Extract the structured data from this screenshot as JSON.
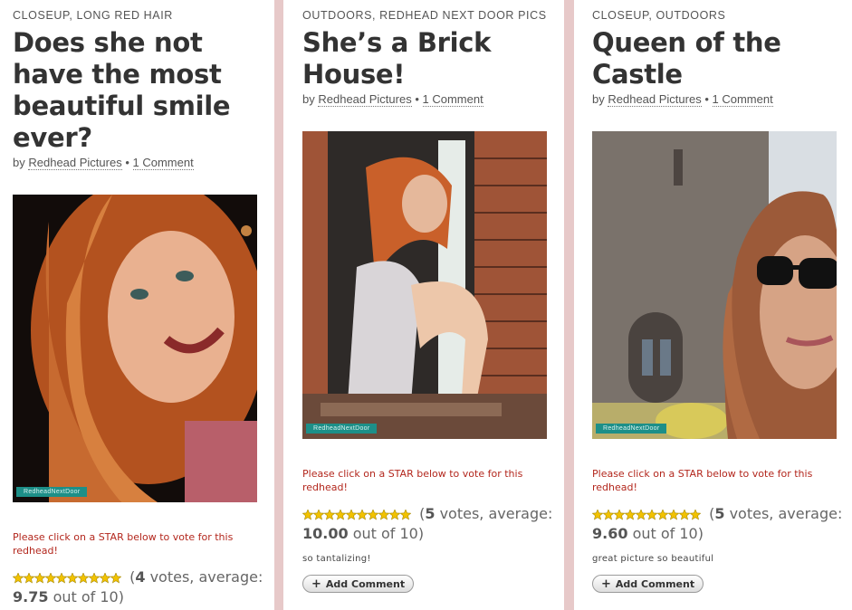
{
  "posts": [
    {
      "categories": "CLOSEUP, LONG RED HAIR",
      "title": "Does she not have the most beautiful smile ever?",
      "by": "by",
      "author": "Redhead Pictures",
      "separator": "•",
      "comments_link": "1 Comment",
      "watermark": "RedheadNextDoor",
      "vote_prompt": "Please click on a STAR below to vote for this redhead!",
      "votes": "4",
      "votes_label": "votes, average:",
      "average": "9.75",
      "out_of": "out of 10)",
      "rating_value": 9.75,
      "comment_text": "",
      "add_comment": "",
      "photo_colors": [
        "#2b1a12",
        "#c7632e",
        "#e9b190"
      ]
    },
    {
      "categories": "OUTDOORS, REDHEAD NEXT DOOR PICS",
      "title": "She’s a Brick House!",
      "by": "by",
      "author": "Redhead Pictures",
      "separator": "•",
      "comments_link": "1 Comment",
      "watermark": "RedheadNextDoor",
      "vote_prompt": "Please click on a STAR below to vote for this redhead!",
      "votes": "5",
      "votes_label": "votes, average:",
      "average": "10.00",
      "out_of": "out of 10)",
      "rating_value": 10,
      "comment_text": "so tantalizing!",
      "add_comment": "Add Comment",
      "photo_colors": [
        "#5a2e1f",
        "#a3583a",
        "#e0cfc0"
      ]
    },
    {
      "categories": "CLOSEUP, OUTDOORS",
      "title": "Queen of the Castle",
      "by": "by",
      "author": "Redhead Pictures",
      "separator": "•",
      "comments_link": "1 Comment",
      "watermark": "RedheadNextDoor",
      "vote_prompt": "Please click on a STAR below to vote for this redhead!",
      "votes": "5",
      "votes_label": "votes, average:",
      "average": "9.60",
      "out_of": "out of 10)",
      "rating_value": 9.6,
      "comment_text": "great picture so beautiful",
      "add_comment": "Add Comment",
      "photo_colors": [
        "#6f6a66",
        "#b9b2ab",
        "#c08a6a"
      ]
    }
  ],
  "colors": {
    "page_bg": "#e7c9c9",
    "vote_prompt": "#b3271d",
    "star_fill": "#f2c200",
    "watermark_bg": "#1d8f88"
  }
}
